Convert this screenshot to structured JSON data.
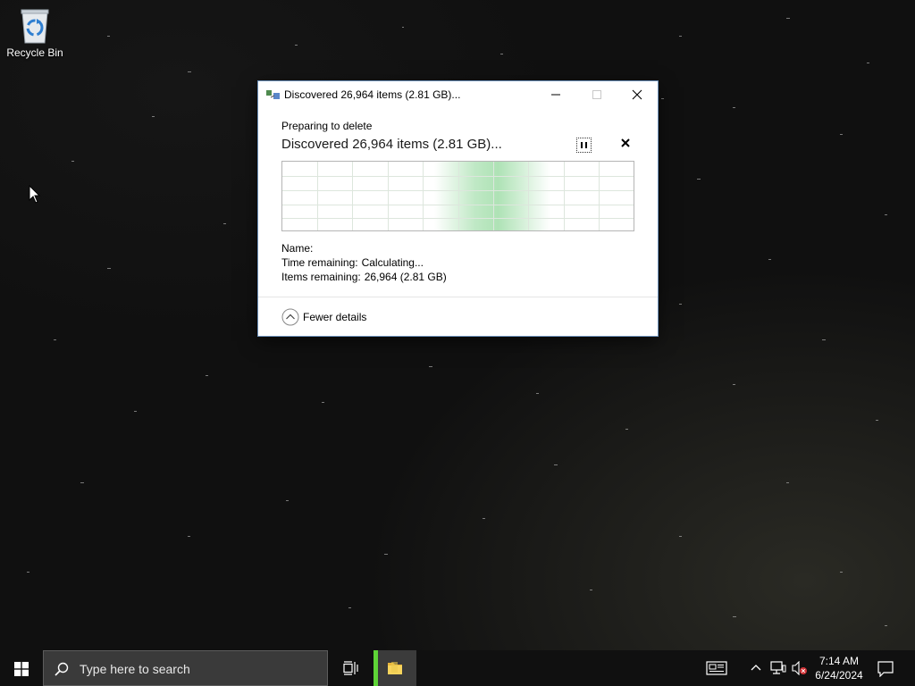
{
  "desktop": {
    "icons": [
      {
        "label": "Recycle Bin",
        "icon": "recycle-bin-icon"
      }
    ]
  },
  "dialog": {
    "title": "Discovered 26,964 items (2.81 GB)...",
    "operation": "Preparing to delete",
    "status": "Discovered 26,964 items (2.81 GB)...",
    "details": {
      "name_label": "Name:",
      "name_value": "",
      "time_label": "Time remaining:",
      "time_value": "Calculating...",
      "items_label": "Items remaining:",
      "items_value": "26,964 (2.81 GB)"
    },
    "toggle_label": "Fewer details",
    "progress_indicator": "indeterminate",
    "colors": {
      "graph_fill": "#8cd696",
      "grid": "#d8e8d8"
    }
  },
  "taskbar": {
    "search_placeholder": "Type here to search",
    "time": "7:14 AM",
    "date": "6/24/2024",
    "active_app": "file-explorer",
    "accent_color": "#5ed437"
  }
}
